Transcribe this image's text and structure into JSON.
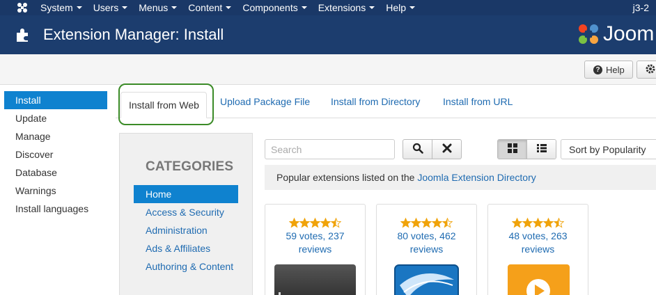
{
  "topnav": {
    "logo_icon": "joomla-icon",
    "menu": [
      "System",
      "Users",
      "Menus",
      "Content",
      "Components",
      "Extensions",
      "Help"
    ],
    "site_name": "j3-2"
  },
  "header": {
    "icon": "puzzle-icon",
    "title": "Extension Manager: Install",
    "brand": "Joom"
  },
  "toolbar": {
    "help_label": "Help",
    "options_icon": "gear-icon"
  },
  "sidebar": {
    "items": [
      "Install",
      "Update",
      "Manage",
      "Discover",
      "Database",
      "Warnings",
      "Install languages"
    ],
    "active": "Install"
  },
  "tabs": {
    "items": [
      "Install from Web",
      "Upload Package File",
      "Install from Directory",
      "Install from URL"
    ],
    "active": "Install from Web"
  },
  "categories": {
    "title": "CATEGORIES",
    "items": [
      "Home",
      "Access & Security",
      "Administration",
      "Ads & Affiliates",
      "Authoring & Content"
    ],
    "active": "Home"
  },
  "search": {
    "placeholder": "Search",
    "search_icon": "search-icon",
    "clear_icon": "close-icon"
  },
  "view": {
    "grid_icon": "grid-view-icon",
    "list_icon": "list-view-icon",
    "active": "grid"
  },
  "sort": {
    "selected": "Sort by Popularity"
  },
  "info": {
    "text": "Popular extensions listed on the ",
    "link": "Joomla Extension Directory"
  },
  "extensions": [
    {
      "rating": 4.5,
      "votes_text": "59 votes, 237 reviews"
    },
    {
      "rating": 4.5,
      "votes_text": "80 votes, 462 reviews"
    },
    {
      "rating": 4.5,
      "votes_text": "48 votes, 263 reviews"
    }
  ],
  "colors": {
    "nav_bg": "#1a3867",
    "header_bg": "#1c3d6e",
    "accent": "#0f82cf",
    "link": "#1f6bb1",
    "star": "#f0a30a",
    "highlight": "#3b8b27"
  }
}
